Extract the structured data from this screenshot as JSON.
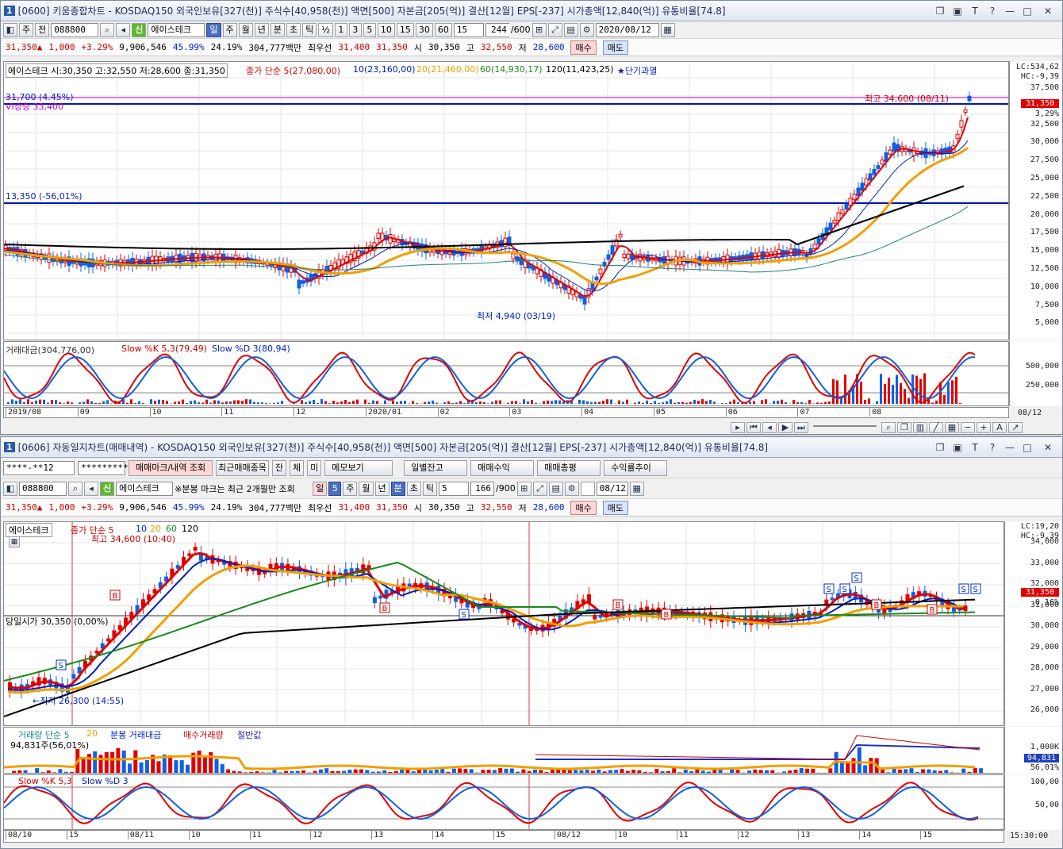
{
  "top": {
    "title": "[0600] 키움종합차트 - KOSDAQ150 외국인보유[327(천)] 주식수[40,958(천)] 액면[500] 자본금[205(억)] 결산[12월] EPS[-237] 시가총액[12,840(억)] 유통비율[74.8]",
    "winnum": "1",
    "toolbar": {
      "period": "주",
      "prev": "전",
      "code": "088800",
      "market_badge": "신",
      "name": "에이스테크",
      "tabs": [
        "일",
        "주",
        "월",
        "년",
        "분",
        "초",
        "틱"
      ],
      "active_tab": "일",
      "half": "½",
      "nums": [
        "1",
        "3",
        "5",
        "10",
        "15",
        "30",
        "60"
      ],
      "unit": "15",
      "count": "244",
      "countmax": "/600",
      "date": "2020/08/12"
    },
    "quote": {
      "price": "31,350▲",
      "change": "1,000",
      "pct": "+3.29%",
      "volume": "9,906,546",
      "r1": "45.99%",
      "r2": "24.19%",
      "amount": "304,777백만",
      "pref": "최우선",
      "ask": "31,400",
      "bid": "31,350",
      "open_l": "시",
      "open": "30,350",
      "high_l": "고",
      "high": "32,550",
      "low_l": "저",
      "low": "28,600",
      "buy": "매수",
      "sell": "매도"
    },
    "legend": {
      "stock": "에이스테크 시:30,350 고:32,550 저:28,600 종:31,350",
      "ma_title": "종가 단순 5(27,080,00)",
      "ma10": "10(23,160,00)",
      "ma20": "20(21,460,00)",
      "ma60": "60(14,930,17)",
      "ma120": "120(11,423,25)",
      "star": "★단기과열"
    },
    "labels": {
      "line1": "31,700 (4.45%)",
      "vi": "VI상승 33,400",
      "line2": "13,350 (-56,01%)",
      "high": "최고 34,600 (08/11)",
      "low": "최저 4,940 (03/19)",
      "lc": "LC:534,62",
      "hc": "HC:-9,39",
      "cur": "31,350",
      "curpct": "3,29%"
    },
    "yaxis": [
      "37,500",
      "35,000",
      "32,500",
      "30,000",
      "27,500",
      "25,000",
      "22,500",
      "20,000",
      "17,500",
      "15,000",
      "12,500",
      "10,000",
      "7,500",
      "5,000"
    ],
    "sub": {
      "legend1": "거래대금(304,776,00)",
      "legend2": "Slow %K 5,3(79,49)",
      "legend3": "Slow %D 3(80,94)",
      "y1": "500,000",
      "y2": "250,000"
    },
    "xaxis": [
      "2019/08",
      "09",
      "10",
      "11",
      "12",
      "2020/01",
      "02",
      "03",
      "04",
      "05",
      "06",
      "07",
      "08"
    ],
    "xend": "08/12"
  },
  "bottom": {
    "title": "[0606] 자동일지차트(매매내역) - KOSDAQ150 외국인보유[327(천)] 주식수[40,958(천)] 액면[500] 자본금[205(억)] 결산[12월] EPS[-237] 시가총액[12,840(억)] 유통비율[74.8]",
    "winnum": "1",
    "row1": {
      "account": "****-**12",
      "password": "*********",
      "mark_btn": "매매마크/내역 조회",
      "recent": "최근매매종목",
      "b1": "잔",
      "b2": "체",
      "b3": "미",
      "memo": "메모보기",
      "daily": "일별잔고",
      "profit": "매매수익",
      "total": "매매총평",
      "rate": "수익률추이"
    },
    "row2": {
      "code": "088800",
      "market_badge": "신",
      "name": "에이스테크",
      "note": "※분봉 마크는 최근 2개월만 조회",
      "tab_day": "일",
      "num": "5",
      "tabs": [
        "주",
        "월",
        "년",
        "분",
        "초",
        "틱"
      ],
      "active": "분",
      "unit": "5",
      "count": "166",
      "countmax": "/900",
      "date": "08/12"
    },
    "quote": {
      "price": "31,350▲",
      "change": "1,000",
      "pct": "+3.29%",
      "volume": "9,906,546",
      "r1": "45.99%",
      "r2": "24.19%",
      "amount": "304,777백만",
      "pref": "최우선",
      "ask": "31,400",
      "bid": "31,350",
      "open_l": "시",
      "open": "30,350",
      "high_l": "고",
      "high": "32,550",
      "low_l": "저",
      "low": "28,600",
      "buy": "매수",
      "sell": "매도"
    },
    "legend": {
      "stock": "에이스테크",
      "ma": "종가 단순 5",
      "m10": "10",
      "m20": "20",
      "m60": "60",
      "m120": "120"
    },
    "labels": {
      "high": "최고 34,600 (10:40)",
      "low": "←최저 26,300 (14:55)",
      "open": "당일시가 30,350 (0,00%)",
      "lc": "LC:19,20",
      "hc": "HC:-9,39",
      "cur": "31,350",
      "curpct": "0,16%"
    },
    "yaxis": [
      "34,000",
      "33,000",
      "32,000",
      "31,000",
      "30,000",
      "29,000",
      "28,000",
      "27,000",
      "26,000"
    ],
    "vol": {
      "legend": "거래량 단순 5",
      "l20": "20",
      "l2": "분봉 거래대금",
      "l3": "매수거래량",
      "l4": "절반값",
      "sub": "94,831주(56,01%)",
      "y1": "1,000K",
      "y2": "94,831",
      "y3": "56,01%"
    },
    "stoch": {
      "legend": "Slow %K 5,3",
      "d": "Slow %D 3",
      "y1": "100,00",
      "y2": "50,00"
    },
    "xaxis": [
      "08/10",
      "15",
      "08/11",
      "10",
      "11",
      "12",
      "13",
      "14",
      "15",
      "08/12",
      "10",
      "11",
      "12",
      "13",
      "14",
      "15"
    ],
    "xend": "15:30:00"
  },
  "colors": {
    "up": "#e00000",
    "down": "#1060e0",
    "ma5": "#e00000",
    "ma10": "#0020c0",
    "ma20": "#f0a000",
    "ma60": "#1a8a1a",
    "ma120": "#000000",
    "teal": "#208080"
  }
}
